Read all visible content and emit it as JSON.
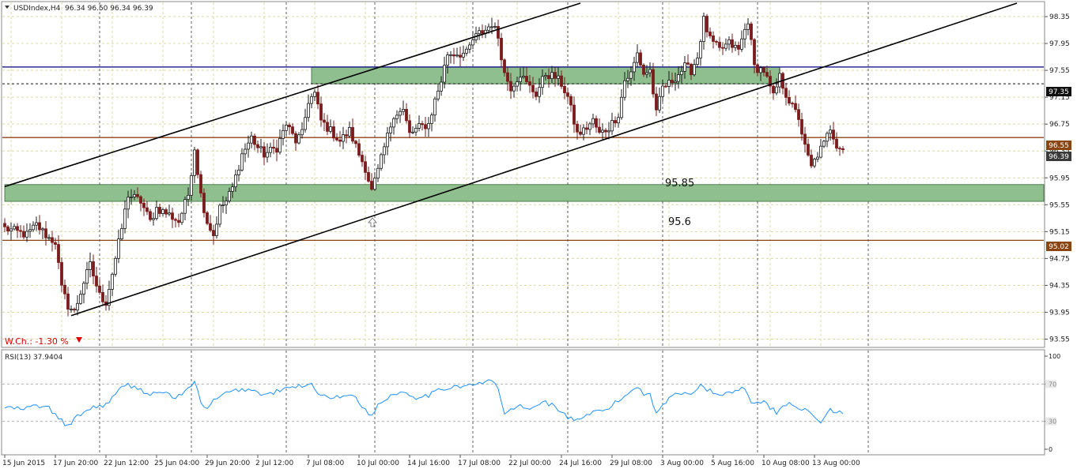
{
  "header": {
    "symbol": "USDIndex,H4",
    "ohlc": "96.34 96.50 96.34 96.39"
  },
  "rsi_label": "RSI(13) 37.9404",
  "weekly_change": {
    "label": "W.Ch.: -1.30 %",
    "direction_icon": "triangle-down-icon"
  },
  "annotations": {
    "zone_top": "95.85",
    "zone_bottom": "95.6"
  },
  "price_badges": {
    "dashed_level": "97.35",
    "upper_resistance": "96.55",
    "current": "96.39",
    "lower_support": "95.02"
  },
  "colors": {
    "background": "#ffffff",
    "bull_candle": "#1a1a1a",
    "bear_candle": "#7b1c1c",
    "grid": "#d9d9a0",
    "vertical_dash": "#3a3a3a",
    "zone_fill": "#8fbf8f",
    "blue_line": "#00007f",
    "brown_line": "#8b4513",
    "rsi_line": "#1e90ff",
    "badge_dark": "#3a3a3a",
    "badge_black": "#111111",
    "badge_brown": "#8b4513",
    "text": "#222222",
    "red_text": "#e00000"
  },
  "chart_data": {
    "type": "candlestick",
    "symbol": "USDIndex",
    "timeframe": "H4",
    "price_axis": {
      "ylim": [
        93.45,
        98.55
      ],
      "ticks": [
        "98.35",
        "97.95",
        "97.55",
        "97.15",
        "96.75",
        "96.35",
        "95.95",
        "95.55",
        "95.15",
        "94.75",
        "94.35",
        "93.95",
        "93.55"
      ]
    },
    "x_axis": {
      "labels": [
        "15 Jun 2015",
        "17 Jun 20:00",
        "22 Jun 12:00",
        "25 Jun 04:00",
        "29 Jun 20:00",
        "2 Jul 12:00",
        "7 Jul 08:00",
        "10 Jul 00:00",
        "14 Jul 16:00",
        "17 Jul 08:00",
        "22 Jul 00:00",
        "24 Jul 16:00",
        "29 Jul 08:00",
        "3 Aug 00:00",
        "5 Aug 16:00",
        "10 Aug 08:00",
        "13 Aug 00:00"
      ],
      "label_index": [
        0,
        16,
        32,
        48,
        64,
        80,
        96,
        112,
        128,
        144,
        160,
        176,
        192,
        208,
        224,
        240,
        256
      ],
      "separator_index": [
        30,
        59,
        89,
        117,
        148,
        178,
        208,
        238,
        273
      ]
    },
    "horizontal_levels": [
      {
        "value": 97.6,
        "color": "blue",
        "style": "solid"
      },
      {
        "value": 97.35,
        "color": "black",
        "style": "dashed"
      },
      {
        "value": 96.55,
        "color": "brown",
        "style": "solid"
      },
      {
        "value": 95.02,
        "color": "brown",
        "style": "solid"
      }
    ],
    "zones": [
      {
        "from": 97.35,
        "to": 97.6,
        "start_index": 97,
        "end_index": 245
      },
      {
        "from": 95.6,
        "to": 95.85,
        "start_index": 0,
        "end_index": 336
      }
    ],
    "trendlines": [
      {
        "start": [
          0,
          95.82
        ],
        "end": [
          182,
          98.55
        ]
      },
      {
        "start": [
          21,
          93.9
        ],
        "end": [
          320,
          98.55
        ]
      }
    ],
    "ohlc_anchors": [
      [
        0,
        95.2
      ],
      [
        7,
        95.1
      ],
      [
        10,
        95.25
      ],
      [
        14,
        95.05
      ],
      [
        16,
        95.0
      ],
      [
        18,
        94.3
      ],
      [
        20,
        94.05
      ],
      [
        22,
        93.95
      ],
      [
        25,
        94.4
      ],
      [
        27,
        94.65
      ],
      [
        30,
        94.2
      ],
      [
        32,
        94.1
      ],
      [
        35,
        94.75
      ],
      [
        37,
        95.2
      ],
      [
        39,
        95.7
      ],
      [
        43,
        95.6
      ],
      [
        46,
        95.3
      ],
      [
        48,
        95.5
      ],
      [
        52,
        95.4
      ],
      [
        55,
        95.3
      ],
      [
        58,
        95.7
      ],
      [
        60,
        96.4
      ],
      [
        62,
        95.7
      ],
      [
        64,
        95.3
      ],
      [
        66,
        95.1
      ],
      [
        68,
        95.5
      ],
      [
        70,
        95.6
      ],
      [
        72,
        95.8
      ],
      [
        75,
        96.3
      ],
      [
        78,
        96.55
      ],
      [
        80,
        96.4
      ],
      [
        82,
        96.3
      ],
      [
        86,
        96.4
      ],
      [
        89,
        96.75
      ],
      [
        92,
        96.5
      ],
      [
        94,
        96.6
      ],
      [
        96,
        97.1
      ],
      [
        98,
        97.2
      ],
      [
        100,
        96.8
      ],
      [
        102,
        96.7
      ],
      [
        106,
        96.5
      ],
      [
        109,
        96.65
      ],
      [
        112,
        96.3
      ],
      [
        114,
        96.1
      ],
      [
        116,
        95.75
      ],
      [
        118,
        96.05
      ],
      [
        120,
        96.4
      ],
      [
        123,
        96.9
      ],
      [
        126,
        96.95
      ],
      [
        128,
        96.6
      ],
      [
        131,
        96.7
      ],
      [
        134,
        96.75
      ],
      [
        136,
        97.1
      ],
      [
        138,
        97.4
      ],
      [
        140,
        97.8
      ],
      [
        143,
        97.8
      ],
      [
        146,
        97.8
      ],
      [
        148,
        98.0
      ],
      [
        150,
        98.1
      ],
      [
        152,
        98.15
      ],
      [
        154,
        98.25
      ],
      [
        156,
        98.05
      ],
      [
        158,
        97.5
      ],
      [
        160,
        97.3
      ],
      [
        163,
        97.5
      ],
      [
        165,
        97.35
      ],
      [
        168,
        97.2
      ],
      [
        171,
        97.5
      ],
      [
        174,
        97.45
      ],
      [
        176,
        97.35
      ],
      [
        178,
        97.15
      ],
      [
        181,
        96.6
      ],
      [
        183,
        96.65
      ],
      [
        186,
        96.8
      ],
      [
        188,
        96.6
      ],
      [
        191,
        96.7
      ],
      [
        194,
        96.9
      ],
      [
        196,
        97.4
      ],
      [
        198,
        97.5
      ],
      [
        200,
        97.8
      ],
      [
        202,
        97.5
      ],
      [
        204,
        97.55
      ],
      [
        206,
        96.9
      ],
      [
        208,
        97.3
      ],
      [
        210,
        97.35
      ],
      [
        213,
        97.5
      ],
      [
        215,
        97.6
      ],
      [
        217,
        97.55
      ],
      [
        219,
        97.75
      ],
      [
        221,
        98.3
      ],
      [
        223,
        98.0
      ],
      [
        226,
        97.85
      ],
      [
        229,
        97.95
      ],
      [
        232,
        97.85
      ],
      [
        235,
        98.3
      ],
      [
        237,
        97.6
      ],
      [
        240,
        97.55
      ],
      [
        243,
        97.15
      ],
      [
        245,
        97.45
      ],
      [
        247,
        97.2
      ],
      [
        249,
        97.0
      ],
      [
        251,
        96.85
      ],
      [
        253,
        96.4
      ],
      [
        255,
        96.1
      ],
      [
        257,
        96.3
      ],
      [
        259,
        96.45
      ],
      [
        261,
        96.7
      ],
      [
        263,
        96.45
      ],
      [
        265,
        96.39
      ]
    ],
    "rsi": {
      "period": 13,
      "last_value": 37.9404,
      "ylim": [
        0,
        100
      ],
      "ticks": [
        "100",
        "70",
        "30",
        "0"
      ],
      "levels": [
        70,
        30
      ],
      "anchors": [
        [
          0,
          45
        ],
        [
          6,
          43
        ],
        [
          10,
          47
        ],
        [
          14,
          44
        ],
        [
          17,
          33
        ],
        [
          20,
          25
        ],
        [
          24,
          38
        ],
        [
          28,
          45
        ],
        [
          32,
          48
        ],
        [
          36,
          62
        ],
        [
          38,
          70
        ],
        [
          42,
          66
        ],
        [
          46,
          58
        ],
        [
          50,
          62
        ],
        [
          54,
          55
        ],
        [
          58,
          64
        ],
        [
          60,
          72
        ],
        [
          62,
          52
        ],
        [
          64,
          42
        ],
        [
          66,
          52
        ],
        [
          70,
          60
        ],
        [
          74,
          64
        ],
        [
          78,
          64
        ],
        [
          82,
          58
        ],
        [
          86,
          62
        ],
        [
          90,
          66
        ],
        [
          94,
          68
        ],
        [
          96,
          72
        ],
        [
          100,
          58
        ],
        [
          106,
          55
        ],
        [
          110,
          60
        ],
        [
          114,
          42
        ],
        [
          116,
          35
        ],
        [
          118,
          48
        ],
        [
          122,
          58
        ],
        [
          126,
          62
        ],
        [
          130,
          56
        ],
        [
          134,
          58
        ],
        [
          138,
          64
        ],
        [
          142,
          68
        ],
        [
          146,
          68
        ],
        [
          150,
          70
        ],
        [
          154,
          74
        ],
        [
          156,
          66
        ],
        [
          158,
          37
        ],
        [
          162,
          47
        ],
        [
          166,
          42
        ],
        [
          170,
          52
        ],
        [
          174,
          46
        ],
        [
          178,
          34
        ],
        [
          182,
          30
        ],
        [
          186,
          40
        ],
        [
          190,
          42
        ],
        [
          194,
          52
        ],
        [
          198,
          62
        ],
        [
          200,
          68
        ],
        [
          202,
          60
        ],
        [
          204,
          60
        ],
        [
          206,
          38
        ],
        [
          210,
          56
        ],
        [
          214,
          60
        ],
        [
          218,
          62
        ],
        [
          220,
          70
        ],
        [
          222,
          64
        ],
        [
          226,
          58
        ],
        [
          230,
          62
        ],
        [
          234,
          66
        ],
        [
          236,
          52
        ],
        [
          240,
          50
        ],
        [
          244,
          40
        ],
        [
          248,
          50
        ],
        [
          252,
          44
        ],
        [
          256,
          34
        ],
        [
          258,
          30
        ],
        [
          261,
          42
        ],
        [
          263,
          40
        ],
        [
          265,
          38
        ]
      ]
    }
  }
}
